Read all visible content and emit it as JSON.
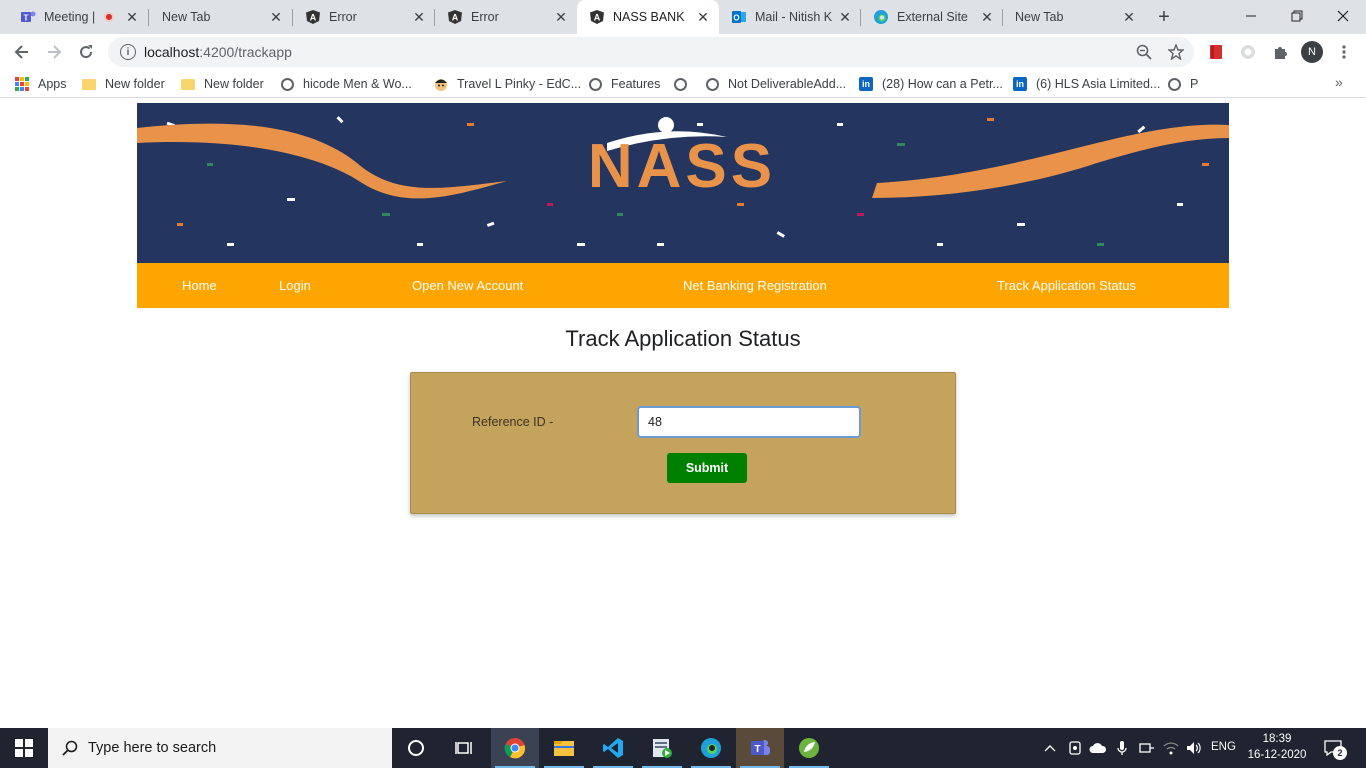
{
  "browser": {
    "tabs": [
      {
        "title": "Meeting |",
        "icon": "teams-icon",
        "recording": true
      },
      {
        "title": "New Tab",
        "icon": ""
      },
      {
        "title": "Error",
        "icon": "angular-icon"
      },
      {
        "title": "Error",
        "icon": "angular-icon"
      },
      {
        "title": "NASS BANK",
        "icon": "angular-icon",
        "active": true
      },
      {
        "title": "Mail - Nitish K",
        "icon": "outlook-icon"
      },
      {
        "title": "External Site",
        "icon": "edge-icon"
      },
      {
        "title": "New Tab",
        "icon": ""
      }
    ],
    "url_host": "localhost",
    "url_rest": ":4200/trackapp",
    "profile_initial": "N",
    "bookmarks": [
      {
        "label": "Apps",
        "icon": "apps-grid-icon"
      },
      {
        "label": "New folder",
        "icon": "folder-icon"
      },
      {
        "label": "New folder",
        "icon": "folder-icon"
      },
      {
        "label": "hicode Men & Wo...",
        "icon": "globe-icon"
      },
      {
        "label": "Travel L Pinky - EdC...",
        "icon": "avatar-icon"
      },
      {
        "label": "Features",
        "icon": "globe-icon"
      },
      {
        "label": "",
        "icon": "globe-icon"
      },
      {
        "label": "Not DeliverableAdd...",
        "icon": "globe-icon"
      },
      {
        "label": "(28) How can a Petr...",
        "icon": "linkedin-icon"
      },
      {
        "label": "(6) HLS Asia Limited...",
        "icon": "linkedin-icon"
      },
      {
        "label": "P",
        "icon": "globe-icon"
      }
    ]
  },
  "site": {
    "logo_text": "NASS",
    "nav": {
      "home": "Home",
      "login": "Login",
      "open_account": "Open New Account",
      "net_banking": "Net Banking Registration",
      "track_status": "Track Application Status"
    },
    "heading": "Track Application Status",
    "form": {
      "reference_label": "Reference ID -",
      "reference_value": "48",
      "submit_label": "Submit"
    },
    "colors": {
      "banner_bg": "#24355f",
      "navbar_bg": "#ffa500",
      "form_bg": "#c4a35c",
      "submit_bg": "#008000"
    }
  },
  "taskbar": {
    "search_placeholder": "Type here to search",
    "language": "ENG",
    "time": "18:39",
    "date": "16-12-2020",
    "notification_count": "2"
  }
}
